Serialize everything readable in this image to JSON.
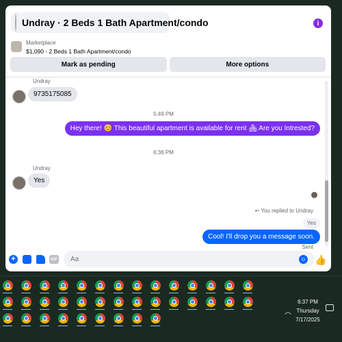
{
  "header": {
    "title": "Undray · 2 Beds 1 Bath Apartment/condo"
  },
  "listing": {
    "source": "Marketplace",
    "title": "$1,090 - 2 Beds 1 Bath Apartment/condo"
  },
  "actions": {
    "mark_pending": "Mark as pending",
    "more_options": "More options"
  },
  "messages": {
    "top_sender": "Undray",
    "msg_phone": "9735175085",
    "time1": "5:49 PM",
    "msg_out1": "Hey there! 😊 This beautiful apartment is available for rent 🏘 Are you Intrested?",
    "time2": "6:36 PM",
    "sender2": "Undray",
    "msg_yes": "Yes",
    "reply_note": "You replied to Undray",
    "quoted": "Yes",
    "msg_out2": "Cool! I'll drop you a message soon.",
    "sent": "Sent"
  },
  "composer": {
    "placeholder": "Aa",
    "gif_label": "GIF"
  },
  "taskbar": {
    "time": "6:37 PM",
    "day": "Thursday",
    "date": "7/17/2025"
  },
  "colors": {
    "outgoing_purple": "#7c30f0",
    "outgoing_blue": "#0866ff",
    "accent": "#0866ff"
  },
  "icons": {
    "info": "info-icon",
    "add": "add-circle-icon",
    "photo": "photo-icon",
    "sticker": "sticker-icon",
    "gif": "gif-icon",
    "emoji": "emoji-icon",
    "like": "thumbs-up-icon",
    "taskbar_app": "chrome-icon"
  }
}
